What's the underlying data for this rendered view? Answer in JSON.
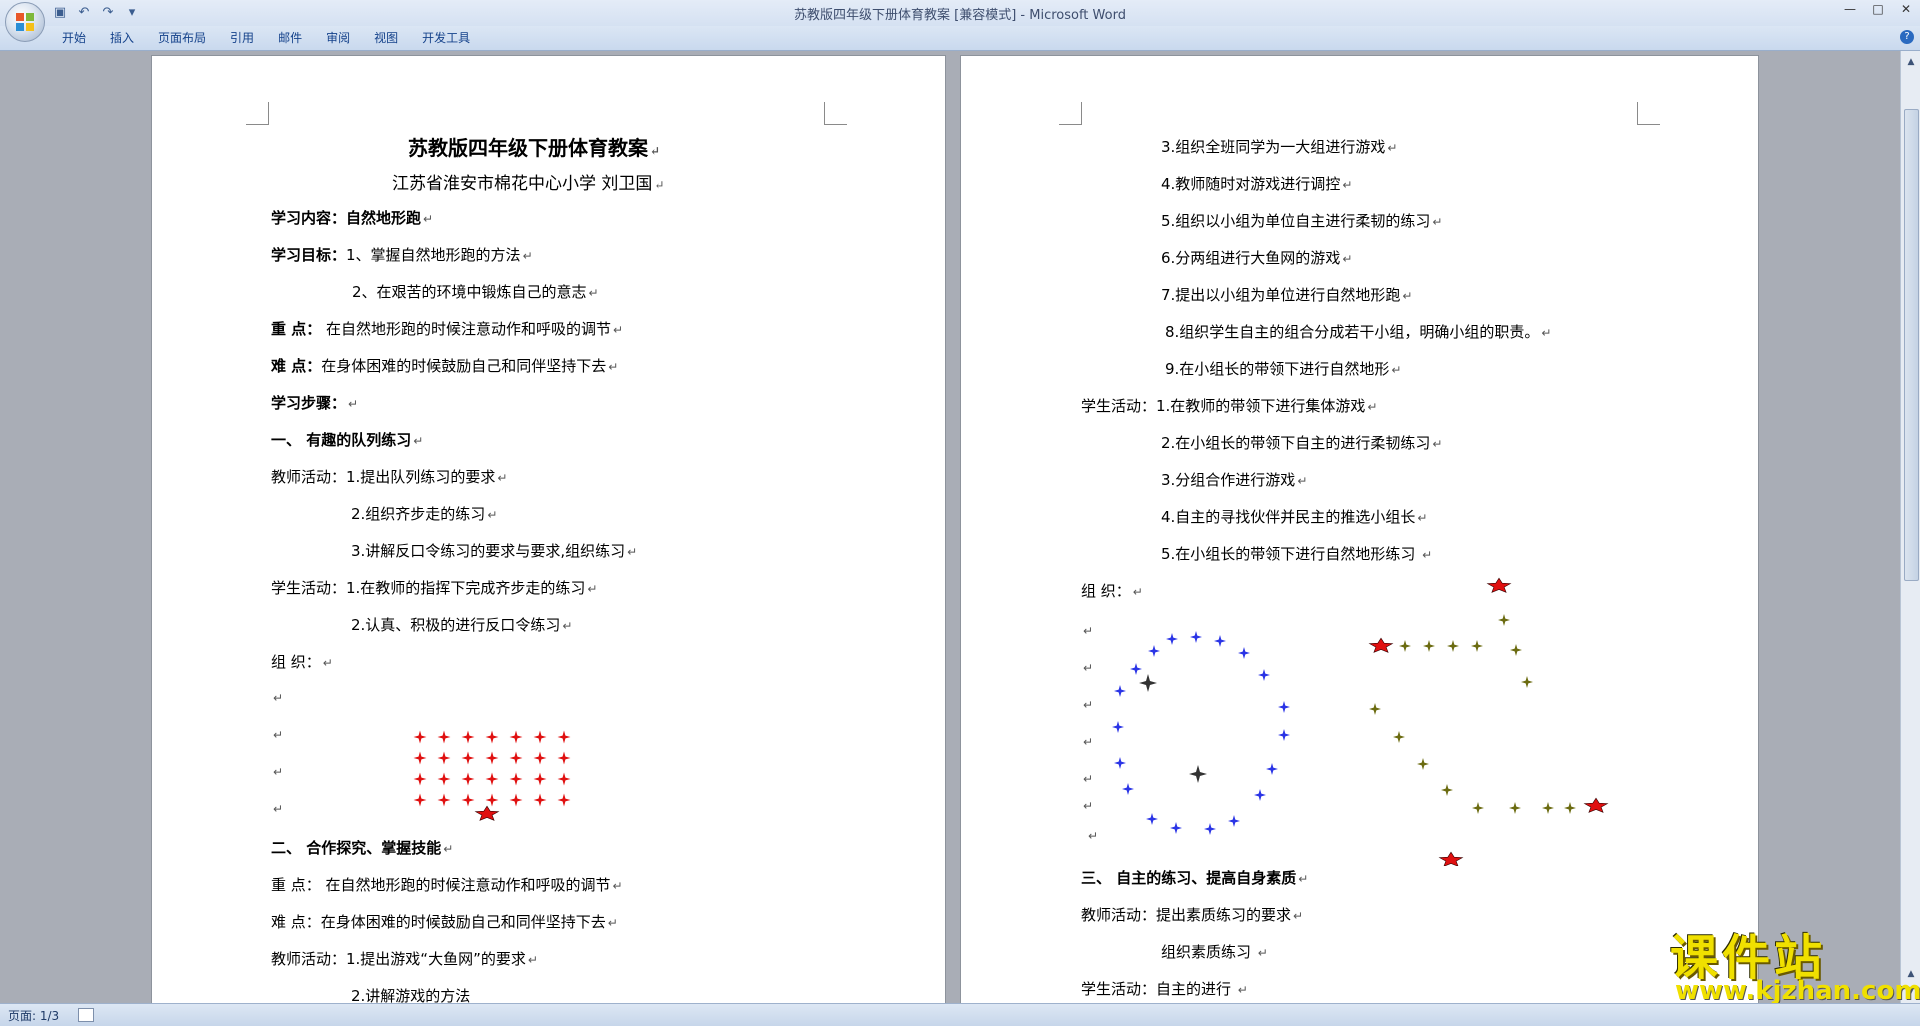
{
  "window": {
    "title": "苏教版四年级下册体育教案 [兼容模式] - Microsoft Word",
    "controls": [
      "—",
      "□",
      "✕"
    ]
  },
  "qat": {
    "save_icon": "save-icon",
    "undo_icon": "undo-icon",
    "redo_icon": "redo-icon",
    "more": "▾"
  },
  "ribbon": {
    "tabs": [
      "开始",
      "插入",
      "页面布局",
      "引用",
      "邮件",
      "审阅",
      "视图",
      "开发工具"
    ],
    "help": "?"
  },
  "page1": {
    "title": "苏教版四年级下册体育教案",
    "subtitle": "江苏省淮安市棉花中心小学   刘卫国",
    "lines": [
      {
        "label": "学习内容：",
        "text": "自然地形跑"
      },
      {
        "label": "学习目标：",
        "text": "1、掌握自然地形跑的方法"
      },
      {
        "label": "",
        "text": "2、在艰苦的环境中锻炼自己的意志"
      },
      {
        "label": "重      点：",
        "text": " 在自然地形跑的时候注意动作和呼吸的调节"
      },
      {
        "label": "难      点：",
        "text": "在身体困难的时候鼓励自己和同伴坚持下去"
      },
      {
        "label": "学习步骤：",
        "text": ""
      },
      {
        "label": "一、       有趣的队列练习",
        "text": ""
      },
      {
        "label": "",
        "text": "教师活动：1.提出队列练习的要求"
      },
      {
        "label": "",
        "text": "2.组织齐步走的练习"
      },
      {
        "label": "",
        "text": "3.讲解反口令练习的要求与要求,组织练习"
      },
      {
        "label": "",
        "text": "学生活动：1.在教师的指挥下完成齐步走的练习"
      },
      {
        "label": "",
        "text": "2.认真、积极的进行反口令练习"
      },
      {
        "label": "",
        "text": "组      织："
      },
      {
        "label": "二、       合作探究、掌握技能",
        "text": ""
      },
      {
        "label": "",
        "text": "重      点：  在自然地形跑的时候注意动作和呼吸的调节"
      },
      {
        "label": "",
        "text": "难      点：在身体困难的时候鼓励自己和同伴坚持下去"
      },
      {
        "label": "",
        "text": "教师活动：1.提出游戏“大鱼网”的要求"
      },
      {
        "label": "",
        "text": "2.讲解游戏的方法"
      }
    ]
  },
  "page2": {
    "lines": [
      "3.组织全班同学为一大组进行游戏",
      "4.教师随时对游戏进行调控",
      "5.组织以小组为单位自主进行柔韧的练习",
      "6.分两组进行大鱼网的游戏",
      "7.提出以小组为单位进行自然地形跑",
      "8.组织学生自主的组合分成若干小组，明确小组的职责。",
      "9.在小组长的带领下进行自然地形",
      "学生活动：1.在教师的带领下进行集体游戏",
      "2.在小组长的带领下自主的进行柔韧练习",
      "3.分组合作进行游戏",
      "4.自主的寻找伙伴并民主的推选小组长",
      "5.在小组长的带领下进行自然地形练习 ",
      "组      织：",
      "三、       自主的练习、提高自身素质",
      "教师活动：提出素质练习的要求",
      "组织素质练习 ",
      "学生活动：自主的进行 "
    ]
  },
  "para_mark": "↵",
  "colors": {
    "accent_red": "#e01010",
    "blue_star": "#2a34e6",
    "olive_star": "#6b6b10",
    "watermark": "#f0e000"
  },
  "status": {
    "page": "页面: 1/3"
  },
  "watermark": {
    "title": "课件站",
    "url": "www.kjzhan.com"
  }
}
